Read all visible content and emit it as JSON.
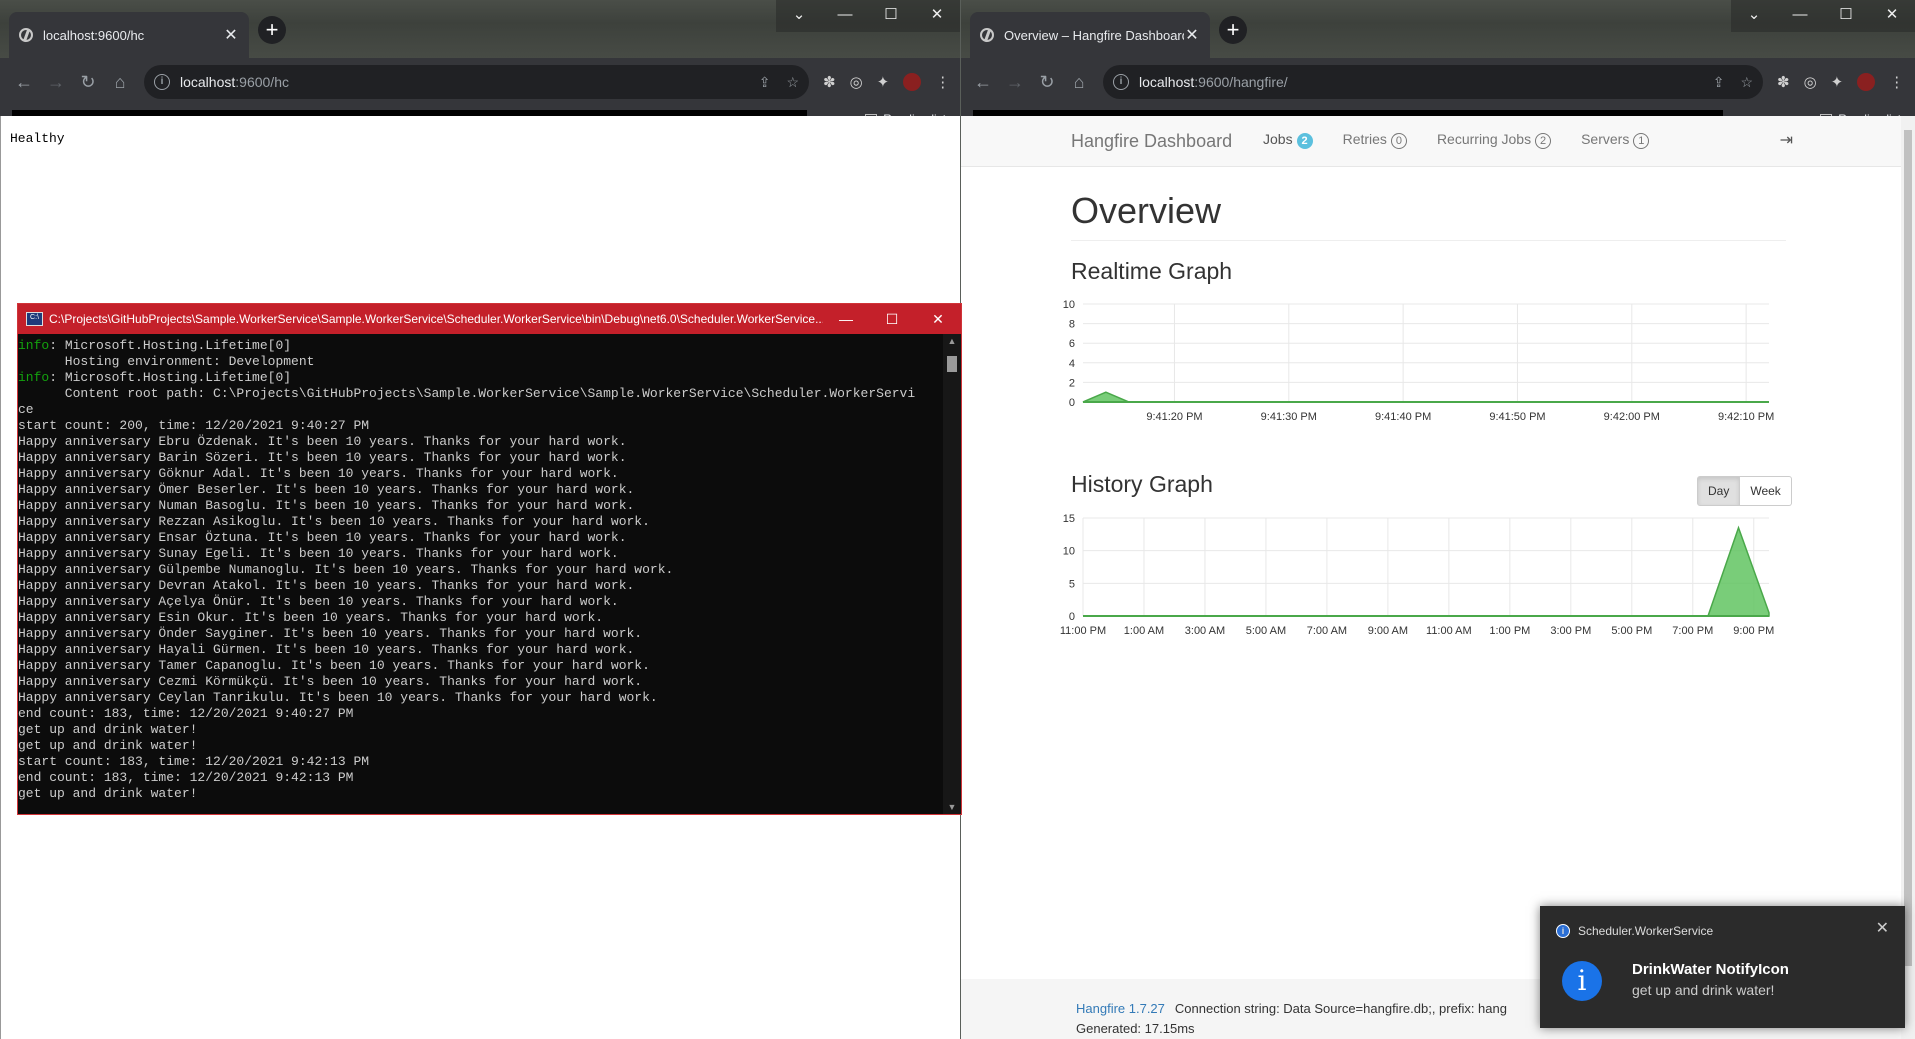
{
  "left_browser": {
    "tab_title": "localhost:9600/hc",
    "tab_close": "✕",
    "new_tab": "+",
    "url_host": "localhost",
    "url_path": ":9600/hc",
    "reading_list": "Reading list",
    "body_text": "Healthy"
  },
  "right_browser": {
    "tab_title": "Overview – Hangfire Dashboard",
    "tab_close": "✕",
    "new_tab": "+",
    "url_host": "localhost",
    "url_path": ":9600/hangfire/",
    "reading_list": "Reading list"
  },
  "window_controls": {
    "chevron": "⌄",
    "minimize": "—",
    "maximize": "☐",
    "close": "✕"
  },
  "console": {
    "title": "C:\\Projects\\GitHubProjects\\Sample.WorkerService\\Sample.WorkerService\\Scheduler.WorkerService\\bin\\Debug\\net6.0\\Scheduler.WorkerService....",
    "lines": [
      {
        "prefix": "info",
        "text": ": Microsoft.Hosting.Lifetime[0]"
      },
      {
        "prefix": "",
        "text": "      Hosting environment: Development"
      },
      {
        "prefix": "info",
        "text": ": Microsoft.Hosting.Lifetime[0]"
      },
      {
        "prefix": "",
        "text": "      Content root path: C:\\Projects\\GitHubProjects\\Sample.WorkerService\\Sample.WorkerService\\Scheduler.WorkerServi"
      },
      {
        "prefix": "",
        "text": "ce"
      },
      {
        "prefix": "",
        "text": "start count: 200, time: 12/20/2021 9:40:27 PM"
      },
      {
        "prefix": "",
        "text": "Happy anniversary Ebru Özdenak. It's been 10 years. Thanks for your hard work."
      },
      {
        "prefix": "",
        "text": "Happy anniversary Barin Sözeri. It's been 10 years. Thanks for your hard work."
      },
      {
        "prefix": "",
        "text": "Happy anniversary Göknur Adal. It's been 10 years. Thanks for your hard work."
      },
      {
        "prefix": "",
        "text": "Happy anniversary Ömer Beserler. It's been 10 years. Thanks for your hard work."
      },
      {
        "prefix": "",
        "text": "Happy anniversary Numan Basoglu. It's been 10 years. Thanks for your hard work."
      },
      {
        "prefix": "",
        "text": "Happy anniversary Rezzan Asikoglu. It's been 10 years. Thanks for your hard work."
      },
      {
        "prefix": "",
        "text": "Happy anniversary Ensar Öztuna. It's been 10 years. Thanks for your hard work."
      },
      {
        "prefix": "",
        "text": "Happy anniversary Sunay Egeli. It's been 10 years. Thanks for your hard work."
      },
      {
        "prefix": "",
        "text": "Happy anniversary Gülpembe Numanoglu. It's been 10 years. Thanks for your hard work."
      },
      {
        "prefix": "",
        "text": "Happy anniversary Devran Atakol. It's been 10 years. Thanks for your hard work."
      },
      {
        "prefix": "",
        "text": "Happy anniversary Açelya Önür. It's been 10 years. Thanks for your hard work."
      },
      {
        "prefix": "",
        "text": "Happy anniversary Esin Okur. It's been 10 years. Thanks for your hard work."
      },
      {
        "prefix": "",
        "text": "Happy anniversary Önder Sayginer. It's been 10 years. Thanks for your hard work."
      },
      {
        "prefix": "",
        "text": "Happy anniversary Hayali Gürmen. It's been 10 years. Thanks for your hard work."
      },
      {
        "prefix": "",
        "text": "Happy anniversary Tamer Capanoglu. It's been 10 years. Thanks for your hard work."
      },
      {
        "prefix": "",
        "text": "Happy anniversary Cezmi Körmükçü. It's been 10 years. Thanks for your hard work."
      },
      {
        "prefix": "",
        "text": "Happy anniversary Ceylan Tanrikulu. It's been 10 years. Thanks for your hard work."
      },
      {
        "prefix": "",
        "text": "end count: 183, time: 12/20/2021 9:40:27 PM"
      },
      {
        "prefix": "",
        "text": "get up and drink water!"
      },
      {
        "prefix": "",
        "text": "get up and drink water!"
      },
      {
        "prefix": "",
        "text": "start count: 183, time: 12/20/2021 9:42:13 PM"
      },
      {
        "prefix": "",
        "text": "end count: 183, time: 12/20/2021 9:42:13 PM"
      },
      {
        "prefix": "",
        "text": "get up and drink water!"
      }
    ]
  },
  "hangfire": {
    "brand": "Hangfire Dashboard",
    "nav": [
      {
        "label": "Jobs",
        "badge": "2",
        "style": "info"
      },
      {
        "label": "Retries",
        "badge": "0",
        "style": "out"
      },
      {
        "label": "Recurring Jobs",
        "badge": "2",
        "style": "out"
      },
      {
        "label": "Servers",
        "badge": "1",
        "style": "out"
      }
    ],
    "heading": "Overview",
    "realtime_title": "Realtime Graph",
    "history_title": "History Graph",
    "day_button": "Day",
    "week_button": "Week",
    "footer_version": "Hangfire 1.7.27",
    "footer_connection": "Connection string: Data Source=hangfire.db;, prefix: hang",
    "footer_generated": "Generated: 17.15ms"
  },
  "chart_data": [
    {
      "type": "area",
      "title": "Realtime Graph",
      "ylim": [
        0,
        10
      ],
      "yticks": [
        0,
        2,
        4,
        6,
        8,
        10
      ],
      "x_ticks": [
        "9:41:20 PM",
        "9:41:30 PM",
        "9:41:40 PM",
        "9:41:50 PM",
        "9:42:00 PM",
        "9:42:10 PM"
      ],
      "x_seconds": [
        0,
        1,
        2,
        3,
        4,
        5,
        6,
        60
      ],
      "values": [
        0,
        0.5,
        1,
        0.5,
        0,
        0,
        0,
        0
      ],
      "grid": true,
      "color": "#62c462"
    },
    {
      "type": "area",
      "title": "History Graph",
      "ylim": [
        0,
        15
      ],
      "yticks": [
        0,
        5,
        10,
        15
      ],
      "x_ticks": [
        "11:00 PM",
        "1:00 AM",
        "3:00 AM",
        "5:00 AM",
        "7:00 AM",
        "9:00 AM",
        "11:00 AM",
        "1:00 PM",
        "3:00 PM",
        "5:00 PM",
        "7:00 PM",
        "9:00 PM"
      ],
      "x_hours": [
        0,
        20.5,
        21.5,
        22.5
      ],
      "values": [
        0,
        0,
        13.5,
        0.5
      ],
      "grid": true,
      "color": "#62c462"
    }
  ],
  "toast": {
    "app_name": "Scheduler.WorkerService",
    "close": "✕",
    "info_glyph": "i",
    "title": "DrinkWater NotifyIcon",
    "message": "get up and drink water!"
  }
}
